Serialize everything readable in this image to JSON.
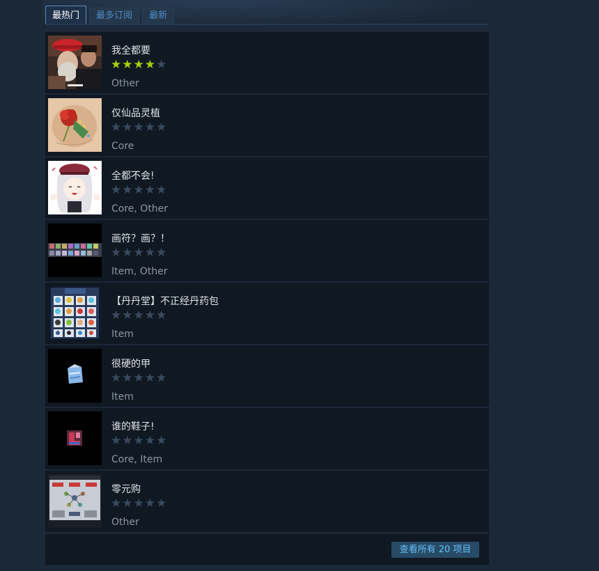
{
  "tabs": [
    {
      "label": "最热门",
      "active": true
    },
    {
      "label": "最多订阅",
      "active": false
    },
    {
      "label": "最新",
      "active": false
    }
  ],
  "items": [
    {
      "title": "我全都要",
      "rating": 4,
      "tags": "Other",
      "thumb": "photo-two-men-red-cap"
    },
    {
      "title": "仅仙品灵植",
      "rating": 0,
      "tags": "Core",
      "thumb": "red-flower-art"
    },
    {
      "title": "全都不会!",
      "rating": 0,
      "tags": "Core, Other",
      "thumb": "anime-girl-beret"
    },
    {
      "title": "画符？画？！",
      "rating": 0,
      "tags": "Item, Other",
      "thumb": "item-strip-dark"
    },
    {
      "title": "【丹丹堂】不正经丹药包",
      "rating": 0,
      "tags": "Item",
      "thumb": "pill-grid-panel"
    },
    {
      "title": "很硬的甲",
      "rating": 0,
      "tags": "Item",
      "thumb": "blue-armor-icon"
    },
    {
      "title": "谁的鞋子!",
      "rating": 0,
      "tags": "Core, Item",
      "thumb": "red-boots-icon"
    },
    {
      "title": "零元购",
      "rating": 0,
      "tags": "Other",
      "thumb": "skill-tree-panel"
    }
  ],
  "footer": {
    "view_all_label": "查看所有 20 项目"
  },
  "colors": {
    "star_on": "#a4d007",
    "star_off": "#3a4b5e",
    "link": "#66c0f4"
  }
}
